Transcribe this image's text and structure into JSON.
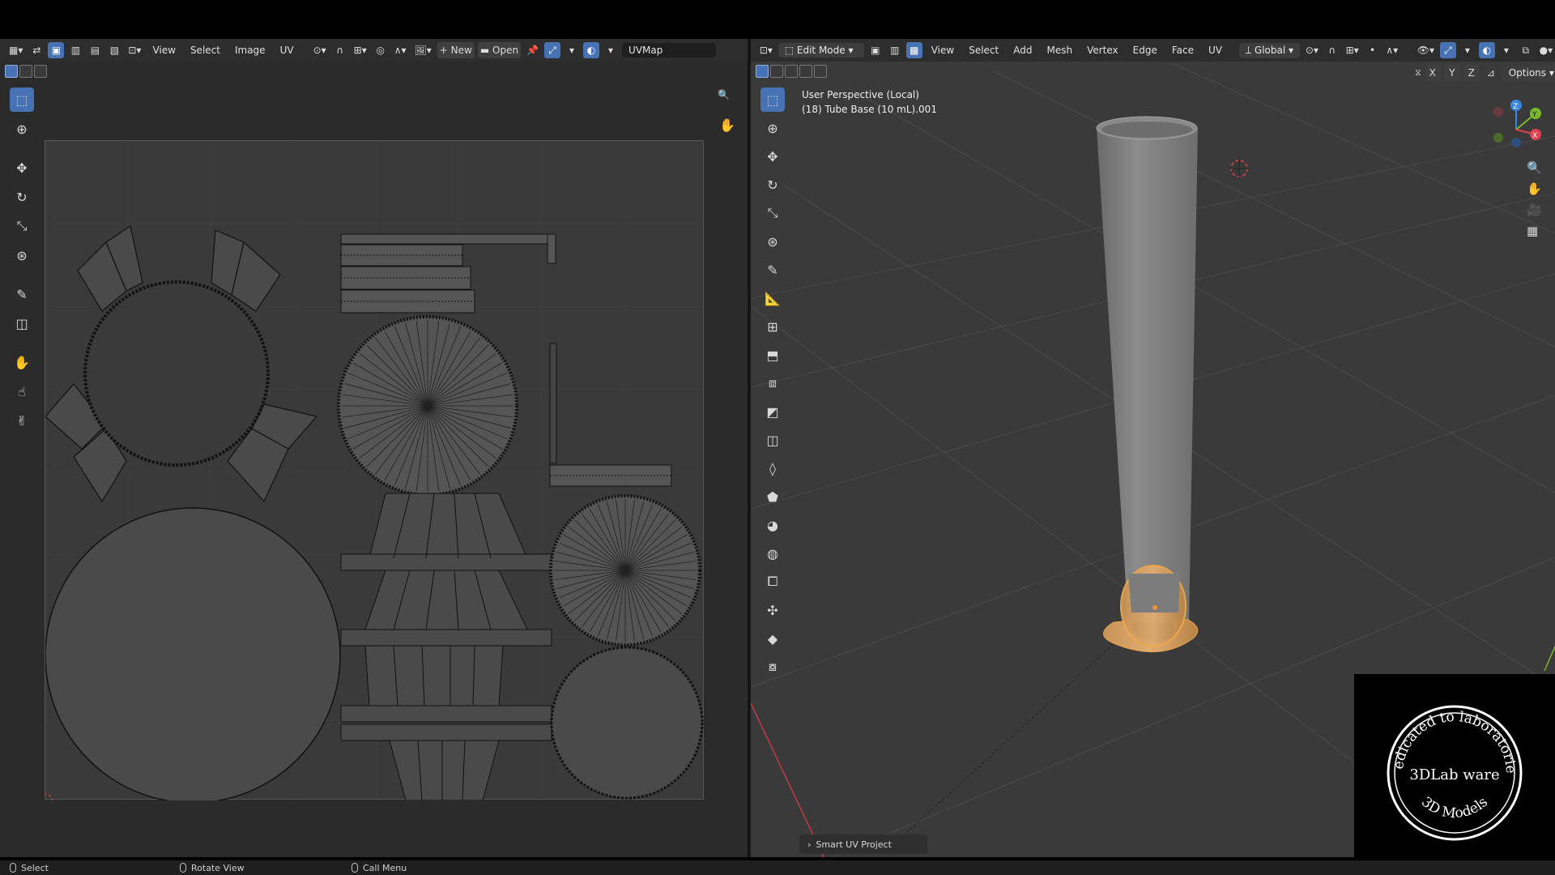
{
  "uv_editor": {
    "menus": [
      "View",
      "Select",
      "Image",
      "UV"
    ],
    "new_label": "New",
    "open_label": "Open",
    "uvmap_value": "UVMap"
  },
  "viewport": {
    "mode": "Edit Mode",
    "menus": [
      "View",
      "Select",
      "Add",
      "Mesh",
      "Vertex",
      "Edge",
      "Face",
      "UV"
    ],
    "orientation": "Global",
    "axes": [
      "X",
      "Y",
      "Z"
    ],
    "options_label": "Options",
    "perspective_label": "User Perspective (Local)",
    "object_label": "(18) Tube Base (10 mL).001",
    "gizmo_axes": {
      "x": "X",
      "y": "Y",
      "z": "Z"
    },
    "colors": {
      "selected": "#e8a04a",
      "x_axis": "#e0424d",
      "y_axis": "#7ab82c",
      "z_axis": "#3c86e0"
    }
  },
  "last_operator": "Smart UV Project",
  "status_bar": {
    "left": "Select",
    "middle": "Rotate View",
    "right": "Call Menu"
  },
  "logo": {
    "arc_top": "Dedicated to laboratories",
    "center": "3DLab ware",
    "arc_bottom": "3D Models"
  }
}
